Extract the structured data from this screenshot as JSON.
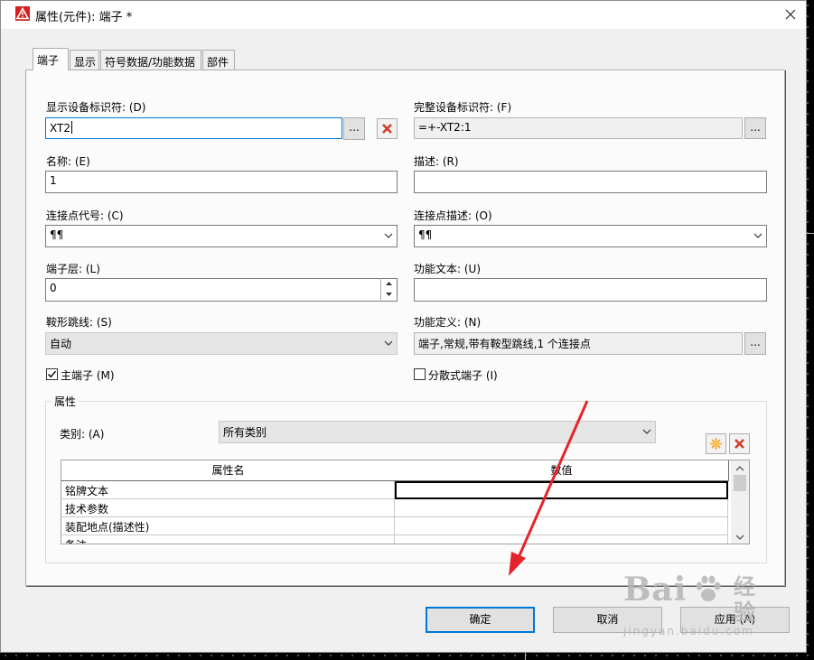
{
  "window": {
    "title": "属性(元件): 端子 *"
  },
  "tabs": [
    {
      "label": "端子",
      "active": true
    },
    {
      "label": "显示",
      "active": false
    },
    {
      "label": "符号数据/功能数据",
      "active": false
    },
    {
      "label": "部件",
      "active": false
    }
  ],
  "fields": {
    "display_dt_label": "显示设备标识符: (D)",
    "display_dt_value": "XT2",
    "full_dt_label": "完整设备标识符: (F)",
    "full_dt_value": "=+-XT2:1",
    "name_label": "名称: (E)",
    "name_value": "1",
    "description_label": "描述: (R)",
    "description_value": "",
    "connection_code_label": "连接点代号: (C)",
    "connection_code_value": "¶¶",
    "connection_desc_label": "连接点描述: (O)",
    "connection_desc_value": "¶¶",
    "terminal_level_label": "端子层: (L)",
    "terminal_level_value": "0",
    "function_text_label": "功能文本: (U)",
    "function_text_value": "",
    "saddle_jumper_label": "鞍形跳线: (S)",
    "saddle_jumper_value": "自动",
    "function_def_label": "功能定义: (N)",
    "function_def_value": "端子,常规,带有鞍型跳线,1 个连接点",
    "main_terminal_label": "主端子 (M)",
    "main_terminal_checked": true,
    "distributed_terminal_label": "分散式端子 (I)",
    "distributed_terminal_checked": false,
    "ellipsis": "..."
  },
  "properties": {
    "group_title": "属性",
    "category_label": "类别: (A)",
    "category_value": "所有类别",
    "columns": [
      "属性名",
      "数值"
    ],
    "rows": [
      {
        "name": "铭牌文本",
        "value": ""
      },
      {
        "name": "技术参数",
        "value": ""
      },
      {
        "name": "装配地点(描述性)",
        "value": ""
      },
      {
        "name": "备注",
        "value": ""
      }
    ]
  },
  "buttons": {
    "ok": "确定",
    "cancel": "取消",
    "apply": "应用 (A)"
  },
  "watermark": {
    "brand": "Bai",
    "cn": "经验",
    "url": "jingyan.baidu.com"
  },
  "colors": {
    "focus_blue": "#0078d7",
    "delete_red": "#d13b2a",
    "new_star": "#f0a020",
    "annotation_red": "#e5242b"
  }
}
